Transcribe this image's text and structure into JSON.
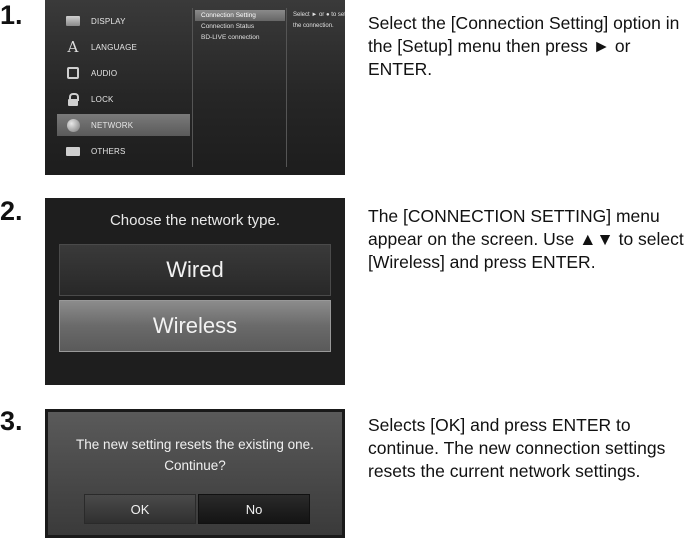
{
  "steps": [
    {
      "number": "1.",
      "description": "Select the [Connection Setting] option in the [Setup] menu then press ► or ENTER.",
      "screen": {
        "menu_items": [
          {
            "label": "DISPLAY",
            "icon": "display-icon"
          },
          {
            "label": "LANGUAGE",
            "icon": "language-icon"
          },
          {
            "label": "AUDIO",
            "icon": "audio-icon"
          },
          {
            "label": "LOCK",
            "icon": "lock-icon"
          },
          {
            "label": "NETWORK",
            "icon": "network-icon",
            "selected": true
          },
          {
            "label": "OTHERS",
            "icon": "others-icon"
          }
        ],
        "sub_items": [
          "Connection Setting",
          "Connection Status",
          "BD-LIVE connection"
        ],
        "hint": "Select ► or ● to set the connection."
      }
    },
    {
      "number": "2.",
      "description": "The [CONNECTION SETTING] menu appear on the screen. Use ▲▼ to select [Wireless] and press ENTER.",
      "screen": {
        "title": "Choose the network type.",
        "options": [
          "Wired",
          "Wireless"
        ],
        "selected": "Wireless"
      }
    },
    {
      "number": "3.",
      "description": "Selects [OK] and press ENTER to continue. The new connection settings resets the current network settings.",
      "screen": {
        "message_line1": "The new setting resets the existing one.",
        "message_line2": "Continue?",
        "buttons": [
          "OK",
          "No"
        ],
        "selected": "OK"
      }
    }
  ],
  "colors": {
    "text": "#111111",
    "screen_bg": "#1e1e1e",
    "highlight": "#7a7a7a"
  }
}
